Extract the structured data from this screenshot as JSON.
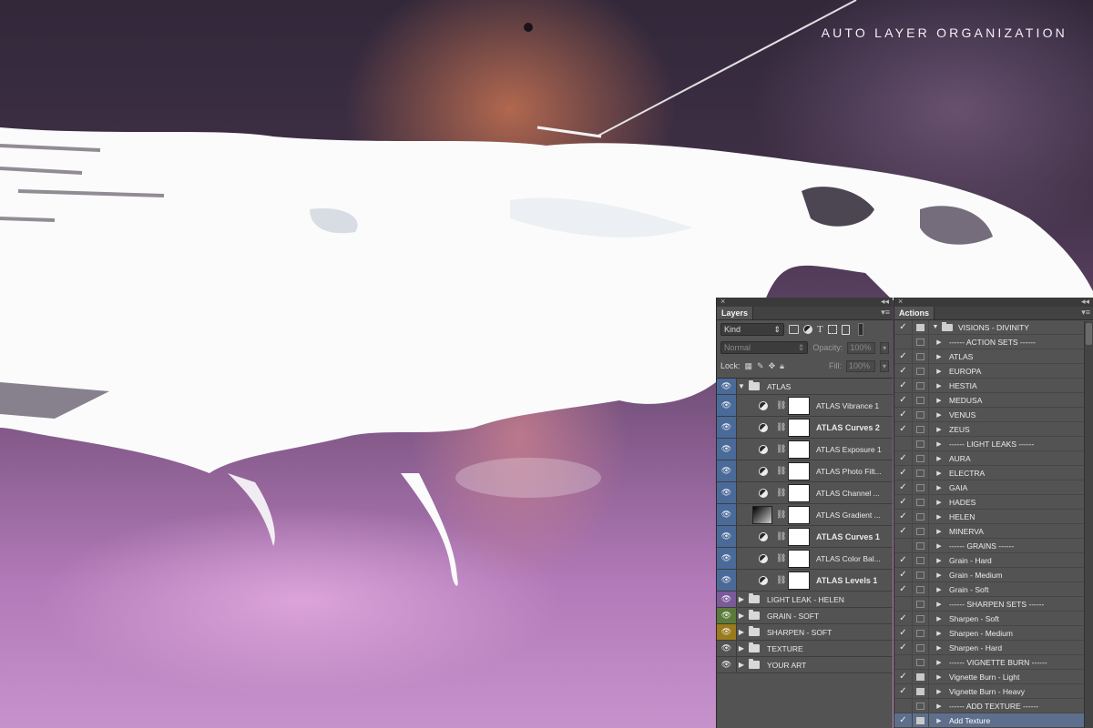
{
  "headline": "AUTO LAYER ORGANIZATION",
  "colors": {
    "panel_bg": "#535353",
    "eye_blue": "#4a6a9a",
    "eye_purple": "#7a5a9a",
    "eye_green": "#5a7a3a",
    "eye_yellow": "#9a7a1a",
    "selection": "#5d6f8c"
  },
  "layers": {
    "close": "×",
    "collapse": "◂◂",
    "tab": "Layers",
    "menu": "▾≡",
    "filter_kind": "Kind",
    "blend_mode": "Normal",
    "opacity_label": "Opacity:",
    "opacity_value": "100%",
    "lock_label": "Lock:",
    "fill_label": "Fill:",
    "fill_value": "100%",
    "group_name": "ATLAS",
    "adjustments": [
      {
        "name": "ATLAS Vibrance 1",
        "bold": false
      },
      {
        "name": "ATLAS Curves 2",
        "bold": true
      },
      {
        "name": "ATLAS Exposure 1",
        "bold": false
      },
      {
        "name": "ATLAS Photo Filt...",
        "bold": false
      },
      {
        "name": "ATLAS Channel ...",
        "bold": false
      },
      {
        "name": "ATLAS Gradient ...",
        "bold": false
      },
      {
        "name": "ATLAS Curves 1",
        "bold": true
      },
      {
        "name": "ATLAS Color Bal...",
        "bold": false
      },
      {
        "name": "ATLAS Levels 1",
        "bold": true
      }
    ],
    "groups": [
      {
        "name": "LIGHT LEAK - HELEN",
        "eye_color": "purple"
      },
      {
        "name": "GRAIN - SOFT",
        "eye_color": "green"
      },
      {
        "name": "SHARPEN - SOFT",
        "eye_color": "yellow"
      },
      {
        "name": "TEXTURE",
        "eye_color": "none"
      },
      {
        "name": "YOUR ART",
        "eye_color": "none"
      }
    ]
  },
  "actions": {
    "close": "×",
    "collapse": "◂◂",
    "tab": "Actions",
    "menu": "▾≡",
    "set_name": "VISIONS - DIVINITY",
    "items": [
      {
        "name": "------ ACTION SETS ------",
        "checked": false,
        "dialog": false
      },
      {
        "name": "ATLAS",
        "checked": true,
        "dialog": false
      },
      {
        "name": "EUROPA",
        "checked": true,
        "dialog": false
      },
      {
        "name": "HESTIA",
        "checked": true,
        "dialog": false
      },
      {
        "name": "MEDUSA",
        "checked": true,
        "dialog": false
      },
      {
        "name": "VENUS",
        "checked": true,
        "dialog": false
      },
      {
        "name": "ZEUS",
        "checked": true,
        "dialog": false
      },
      {
        "name": "------ LIGHT LEAKS ------",
        "checked": false,
        "dialog": false
      },
      {
        "name": "AURA",
        "checked": true,
        "dialog": false
      },
      {
        "name": "ELECTRA",
        "checked": true,
        "dialog": false
      },
      {
        "name": "GAIA",
        "checked": true,
        "dialog": false
      },
      {
        "name": "HADES",
        "checked": true,
        "dialog": false
      },
      {
        "name": "HELEN",
        "checked": true,
        "dialog": false
      },
      {
        "name": "MINERVA",
        "checked": true,
        "dialog": false
      },
      {
        "name": "------ GRAINS ------",
        "checked": false,
        "dialog": false
      },
      {
        "name": "Grain - Hard",
        "checked": true,
        "dialog": false
      },
      {
        "name": "Grain - Medium",
        "checked": true,
        "dialog": false
      },
      {
        "name": "Grain - Soft",
        "checked": true,
        "dialog": false
      },
      {
        "name": "------ SHARPEN SETS  ------",
        "checked": false,
        "dialog": false
      },
      {
        "name": "Sharpen - Soft",
        "checked": true,
        "dialog": false
      },
      {
        "name": "Sharpen - Medium",
        "checked": true,
        "dialog": false
      },
      {
        "name": "Sharpen - Hard",
        "checked": true,
        "dialog": false
      },
      {
        "name": "------ VIGNETTE BURN ------",
        "checked": false,
        "dialog": false
      },
      {
        "name": "Vignette Burn - Light",
        "checked": true,
        "dialog": true
      },
      {
        "name": "Vignette Burn - Heavy",
        "checked": true,
        "dialog": true
      },
      {
        "name": "------ ADD TEXTURE ------",
        "checked": false,
        "dialog": false
      },
      {
        "name": "Add Texture",
        "checked": true,
        "dialog": true,
        "selected": true
      }
    ]
  }
}
